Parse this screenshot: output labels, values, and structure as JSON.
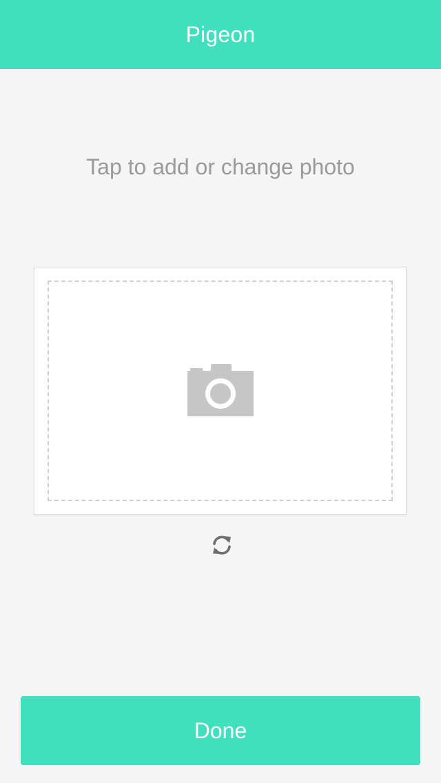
{
  "header": {
    "title": "Pigeon"
  },
  "main": {
    "prompt": "Tap to add or change photo",
    "photo_placeholder_icon": "camera-icon",
    "rotate_icon": "refresh-icon"
  },
  "footer": {
    "done_label": "Done"
  },
  "colors": {
    "accent": "#40dfbe",
    "background": "#f5f5f5",
    "prompt_text": "#9a9a9a",
    "icon_gray": "#c6c6c6"
  }
}
